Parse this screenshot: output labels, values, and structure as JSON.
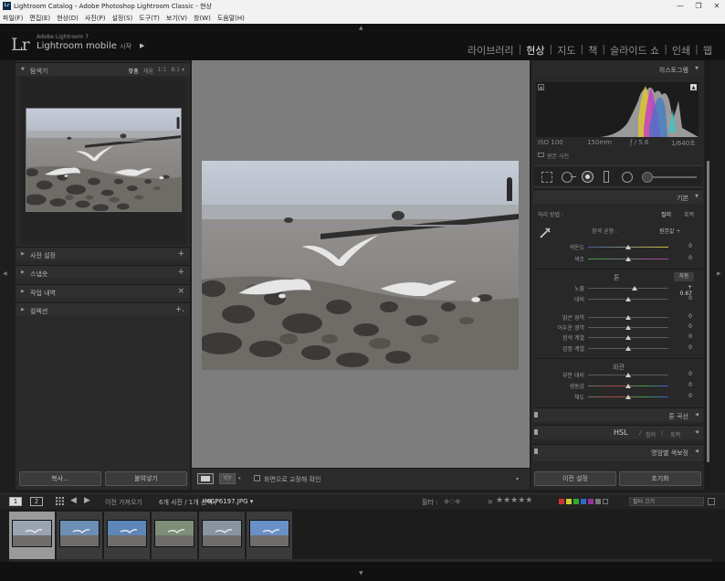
{
  "window": {
    "app_icon": "Lr",
    "title": "Lightroom Catalog - Adobe Photoshop Lightroom Classic - 현상",
    "minimize": "—",
    "maximize": "❐",
    "close": "✕"
  },
  "menu": [
    "파일(F)",
    "편집(E)",
    "현상(D)",
    "사진(P)",
    "설정(S)",
    "도구(T)",
    "보기(V)",
    "창(W)",
    "도움말(H)"
  ],
  "identity": {
    "logo": "Lr",
    "line1": "Adobe Lightroom 7",
    "line2": "Lightroom mobile",
    "line2_suffix": "시작"
  },
  "modules": {
    "items": [
      "라이브러리",
      "현상",
      "지도",
      "책",
      "슬라이드 쇼",
      "인쇄",
      "웹"
    ],
    "active": "현상",
    "separator": "|"
  },
  "left_panel": {
    "navigator": {
      "title": "탐색기",
      "zoom": [
        "맞춤",
        "채움",
        "1:1",
        "8:1 ▾"
      ],
      "zoom_active": "맞춤"
    },
    "sections": [
      {
        "title": "사전 설정",
        "action": "+"
      },
      {
        "title": "스냅숏",
        "action": "+"
      },
      {
        "title": "작업 내역",
        "action": "×"
      },
      {
        "title": "컬렉션",
        "action": "+."
      }
    ],
    "copy_button": "복사...",
    "paste_button": "붙여넣기"
  },
  "center_toolbar": {
    "softproof_label": "화면으로 교정해 확인"
  },
  "right_panel": {
    "histogram": {
      "title": "히스토그램",
      "iso": "ISO 100",
      "focal": "150mm",
      "aperture": "ƒ / 5.6",
      "shutter": "1/640초",
      "original_label": "원본 사진"
    },
    "basic": {
      "title": "기본",
      "treatment_label": "처리 방법 :",
      "treatment_color": "컬러",
      "treatment_bw": "흑백",
      "wb_label": "흰색 균형 :",
      "wb_value": "원본값 ÷",
      "tone_label": "톤",
      "tone_auto": "자동",
      "presence_label": "외관",
      "sliders": [
        {
          "label": "색온도",
          "value": "0",
          "pos": 0.5
        },
        {
          "label": "색조",
          "value": "0",
          "pos": 0.5
        },
        {
          "label": "노출",
          "value": "+ 0.67",
          "pos": 0.58
        },
        {
          "label": "대비",
          "value": "0",
          "pos": 0.5
        },
        {
          "label": "밝은 영역",
          "value": "0",
          "pos": 0.5
        },
        {
          "label": "어두운 영역",
          "value": "0",
          "pos": 0.5
        },
        {
          "label": "흰색 계열",
          "value": "0",
          "pos": 0.5
        },
        {
          "label": "검정 계열",
          "value": "0",
          "pos": 0.5
        },
        {
          "label": "부분 대비",
          "value": "0",
          "pos": 0.5
        },
        {
          "label": "생동감",
          "value": "0",
          "pos": 0.5
        },
        {
          "label": "채도",
          "value": "0",
          "pos": 0.5
        }
      ]
    },
    "sections": {
      "tone_curve": "톤 곡선",
      "hsl": "HSL",
      "hsl_color": "컬러",
      "hsl_bw": "흑백",
      "split_toning": "명암별 색보정"
    },
    "prev_button": "이전 설정",
    "reset_button": "초기화"
  },
  "filmstrip": {
    "page1": "1",
    "page2": "2",
    "source": "이전 가져오기",
    "count": "6개 사진 / 1개 선택 /",
    "filename": "IMGP6197.JPG ▾",
    "filter_label": "필터 :",
    "filter_value": "필터 끄기",
    "stars": "★★★★★",
    "thumb_count": 6
  }
}
